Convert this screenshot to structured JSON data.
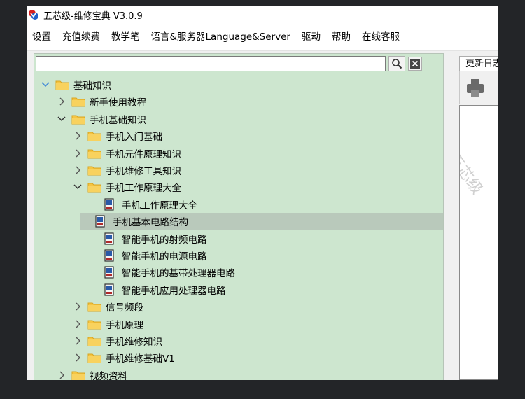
{
  "window": {
    "title": "五芯级-维修宝典 V3.0.9",
    "logo_icon": "app-logo-icon"
  },
  "menu": [
    "设置",
    "充值续费",
    "教学笔",
    "语言&服务器Language&Server",
    "驱动",
    "帮助",
    "在线客服"
  ],
  "search": {
    "value": "",
    "search_icon": "magnifier-icon",
    "clear_icon": "close-x-icon"
  },
  "tree": [
    {
      "label": "基础知识",
      "level": 0,
      "state": "expanded",
      "icon": "folder-icon"
    },
    {
      "label": "新手使用教程",
      "level": 1,
      "state": "collapsed",
      "icon": "folder-icon"
    },
    {
      "label": "手机基础知识",
      "level": 1,
      "state": "expanded",
      "icon": "folder-icon"
    },
    {
      "label": "手机入门基础",
      "level": 2,
      "state": "collapsed",
      "icon": "folder-icon"
    },
    {
      "label": "手机元件原理知识",
      "level": 2,
      "state": "collapsed",
      "icon": "folder-icon"
    },
    {
      "label": "手机维修工具知识",
      "level": 2,
      "state": "collapsed",
      "icon": "folder-icon"
    },
    {
      "label": "手机工作原理大全",
      "level": 2,
      "state": "expanded",
      "icon": "folder-icon"
    },
    {
      "label": "手机工作原理大全",
      "level": 3,
      "state": "leaf",
      "icon": "document-icon"
    },
    {
      "label": "手机基本电路结构",
      "level": 3,
      "state": "leaf",
      "icon": "document-icon",
      "selected": true
    },
    {
      "label": "智能手机的射频电路",
      "level": 3,
      "state": "leaf",
      "icon": "document-icon"
    },
    {
      "label": "智能手机的电源电路",
      "level": 3,
      "state": "leaf",
      "icon": "document-icon"
    },
    {
      "label": "智能手机的基带处理器电路",
      "level": 3,
      "state": "leaf",
      "icon": "document-icon"
    },
    {
      "label": "智能手机应用处理器电路",
      "level": 3,
      "state": "leaf",
      "icon": "document-icon"
    },
    {
      "label": "信号频段",
      "level": 2,
      "state": "collapsed",
      "icon": "folder-icon"
    },
    {
      "label": "手机原理",
      "level": 2,
      "state": "collapsed",
      "icon": "folder-icon"
    },
    {
      "label": "手机维修知识",
      "level": 2,
      "state": "collapsed",
      "icon": "folder-icon"
    },
    {
      "label": "手机维修基础V1",
      "level": 2,
      "state": "collapsed",
      "icon": "folder-icon"
    },
    {
      "label": "视频资料",
      "level": 1,
      "state": "collapsed",
      "icon": "folder-icon"
    }
  ],
  "right_panel": {
    "tab_label": "更新日志",
    "toolbar_icon": "print-icon",
    "watermark": "五芯级"
  },
  "colors": {
    "tree_background": "#cde6cf",
    "selection": "#b9c9bb",
    "folder": "#f5c542",
    "expand_arrow": "#4a8fd6"
  }
}
